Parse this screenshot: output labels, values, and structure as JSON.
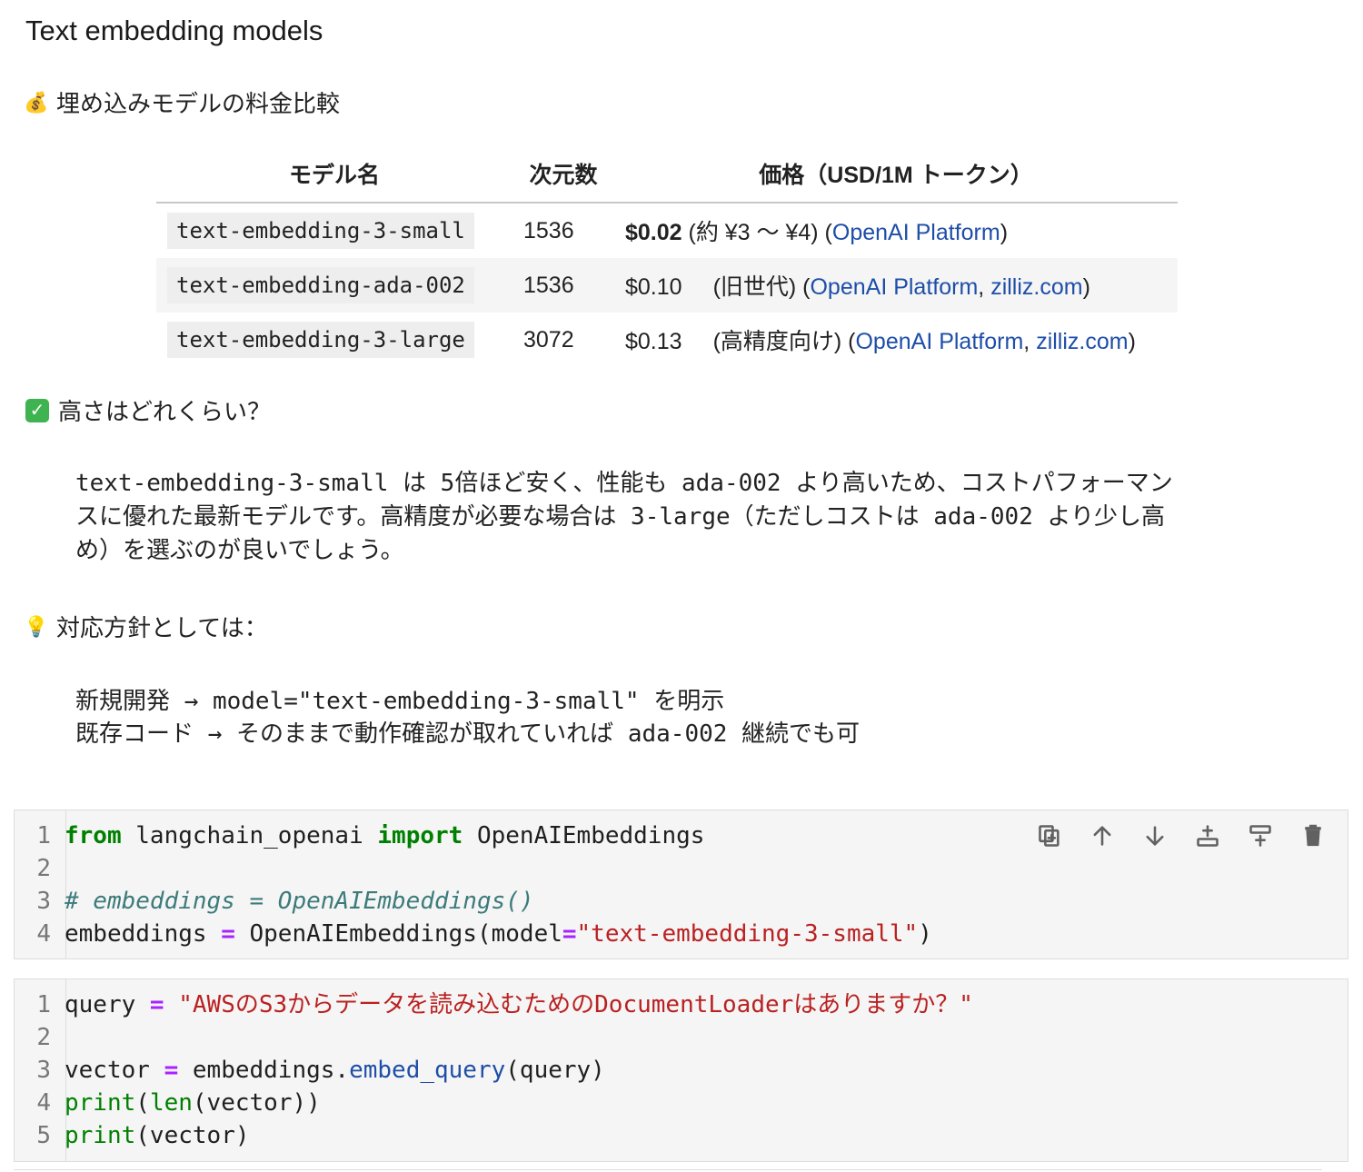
{
  "heading": "Text embedding models",
  "pricing_intro": {
    "emoji": "💰",
    "text": "埋め込みモデルの料金比較"
  },
  "table": {
    "headers": [
      "モデル名",
      "次元数",
      "価格（USD/1M トークン）"
    ],
    "rows": [
      {
        "model": "text-embedding-3-small",
        "dims": "1536",
        "price": "$0.02",
        "note": " (約 ¥3 〜 ¥4) (",
        "links": [
          "OpenAI Platform"
        ],
        "close": ")"
      },
      {
        "model": "text-embedding-ada-002",
        "dims": "1536",
        "price": "$0.10",
        "note": "(旧世代) (",
        "links": [
          "OpenAI Platform",
          "zilliz.com"
        ],
        "close": ")"
      },
      {
        "model": "text-embedding-3-large",
        "dims": "3072",
        "price": "$0.13",
        "note": "(高精度向け) (",
        "links": [
          "OpenAI Platform",
          "zilliz.com"
        ],
        "close": ")"
      }
    ],
    "link_separator": ", "
  },
  "height_question": {
    "emoji": "✓",
    "text": "高さはどれくらい？"
  },
  "explanation_lines": [
    "text-embedding-3-small は 5倍ほど安く、性能も ada-002 より高いため、コストパフォーマン",
    "スに優れた最新モデルです。高精度が必要な場合は 3-large（ただしコストは ada-002 より少し高",
    "め）を選ぶのが良いでしょう。"
  ],
  "policy_intro": {
    "emoji": "💡",
    "text": "対応方針としては："
  },
  "policy_lines": [
    "新規開発 → model=\"text-embedding-3-small\" を明示",
    "既存コード → そのままで動作確認が取れていれば ada-002 継続でも可"
  ],
  "cell1": {
    "line_numbers": [
      "1",
      "2",
      "3",
      "4"
    ],
    "l1": {
      "kw1": "from",
      "mod": " langchain_openai ",
      "kw2": "import",
      "cls": " OpenAIEmbeddings"
    },
    "l3": "# embeddings = OpenAIEmbeddings()",
    "l4": {
      "var": "embeddings ",
      "eq": "=",
      "call": " OpenAIEmbeddings(model",
      "eq2": "=",
      "str": "\"text-embedding-3-small\"",
      "close": ")"
    }
  },
  "cell2": {
    "line_numbers": [
      "1",
      "2",
      "3",
      "4",
      "5"
    ],
    "l1": {
      "var": "query ",
      "eq": "=",
      "str": " \"AWSのS3からデータを読み込むためのDocumentLoaderはありますか？\""
    },
    "l3": {
      "var": "vector ",
      "eq": "=",
      "obj": " embeddings.",
      "method": "embed_query",
      "args": "(query)"
    },
    "l4": {
      "fn1": "print",
      "p1": "(",
      "fn2": "len",
      "rest": "(vector))"
    },
    "l5": {
      "fn": "print",
      "rest": "(vector)"
    }
  },
  "toolbar_icons": [
    "duplicate-icon",
    "move-up-icon",
    "move-down-icon",
    "insert-above-icon",
    "insert-below-icon",
    "delete-icon"
  ],
  "colors": {
    "keyword": "#008000",
    "string": "#ba2121",
    "comment": "#3d7b7b",
    "operator": "#aa22ff",
    "link": "#1e4ea8",
    "cell_bg": "#f5f5f5"
  }
}
